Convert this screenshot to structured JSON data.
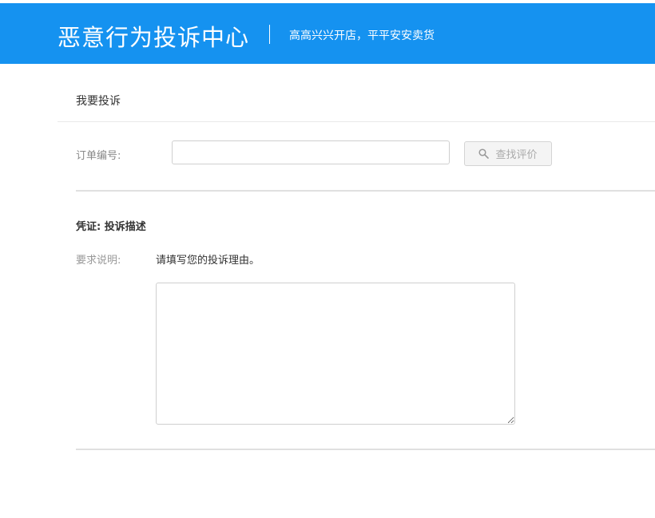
{
  "header": {
    "title": "恶意行为投诉中心",
    "slogan": "高高兴兴开店，平平安安卖货",
    "bg_color": "#1592f0"
  },
  "complaint": {
    "section_title": "我要投诉",
    "order_label": "订单编号:",
    "order_value": "",
    "search_button": "查找评价",
    "search_icon": "search-icon"
  },
  "evidence": {
    "title": "凭证: 投诉描述",
    "requirement_label": "要求说明:",
    "requirement_text": "请填写您的投诉理由。",
    "description_value": ""
  }
}
